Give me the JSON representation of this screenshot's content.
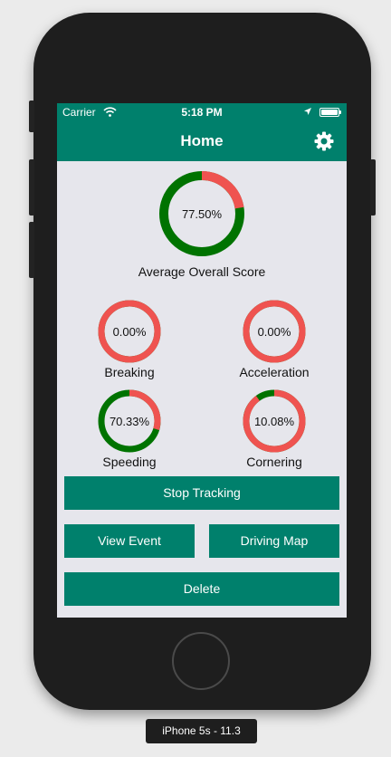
{
  "status_bar": {
    "carrier": "Carrier",
    "time": "5:18 PM"
  },
  "nav": {
    "title": "Home",
    "settings_icon": "gear-icon"
  },
  "colors": {
    "accent": "#00806c",
    "gauge_good": "#007300",
    "gauge_bad": "#ef5350"
  },
  "overall": {
    "value": "77.50%",
    "label": "Average Overall Score",
    "fraction": 0.775
  },
  "gauges": [
    {
      "key": "breaking",
      "value": "0.00%",
      "label": "Breaking",
      "fraction": 0.0
    },
    {
      "key": "acceleration",
      "value": "0.00%",
      "label": "Acceleration",
      "fraction": 0.0
    },
    {
      "key": "speeding",
      "value": "70.33%",
      "label": "Speeding",
      "fraction": 0.7033
    },
    {
      "key": "cornering",
      "value": "10.08%",
      "label": "Cornering",
      "fraction": 0.1008
    }
  ],
  "buttons": {
    "stop_tracking": "Stop Tracking",
    "view_event": "View Event",
    "driving_map": "Driving Map",
    "delete": "Delete"
  },
  "device_label": "iPhone 5s - 11.3"
}
